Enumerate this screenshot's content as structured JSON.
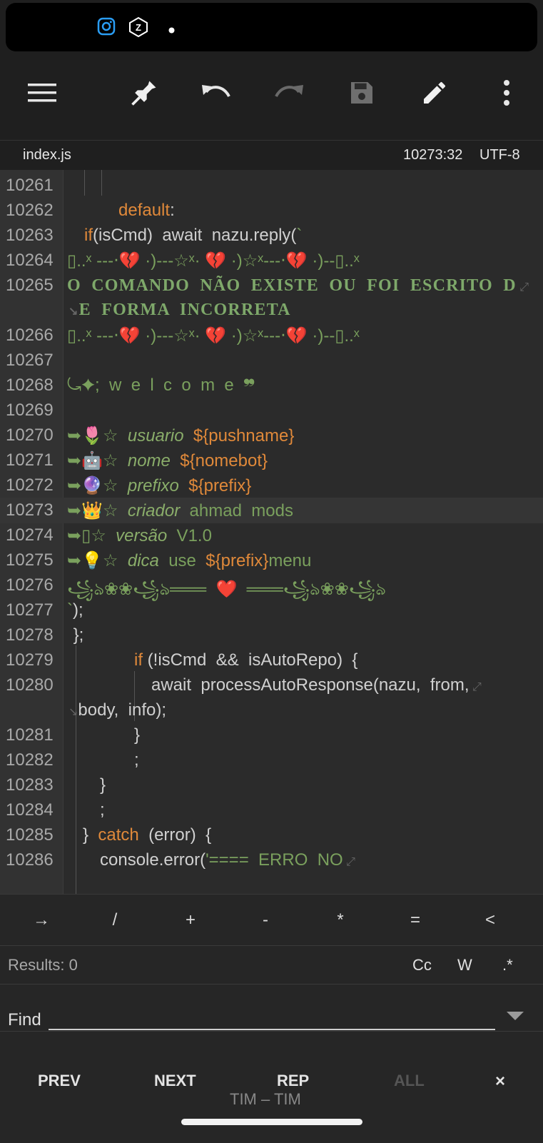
{
  "status_bar": {
    "icons": [
      "instagram-icon",
      "zapp-icon",
      "dot-icon"
    ]
  },
  "toolbar": {
    "icons": [
      "menu-icon",
      "pin-icon",
      "undo-icon",
      "redo-icon",
      "save-icon",
      "edit-icon",
      "more-vert-icon"
    ]
  },
  "file": {
    "name": "index.js",
    "position": "10273:32",
    "encoding": "UTF-8"
  },
  "editor": {
    "lines": [
      {
        "n": "10261"
      },
      {
        "n": "10262",
        "parts": [
          {
            "t": "default",
            "c": "kw"
          },
          {
            "t": ":",
            "c": ""
          }
        ],
        "indent": 166
      },
      {
        "n": "10263",
        "parts": [
          {
            "t": "if",
            "c": "kw"
          },
          {
            "t": "(isCmd)  await  nazu.reply(",
            "c": ""
          },
          {
            "t": "`",
            "c": "str"
          }
        ],
        "indent": 118
      },
      {
        "n": "10264",
        "parts": [
          {
            "t": "▯..ˣ ---‧💔 ·)---☆ˣ· 💔 ·)☆ˣ---‧💔 ·)--▯..ˣ",
            "c": "str"
          }
        ],
        "indent": 94
      },
      {
        "n": "10265",
        "parts": [
          {
            "t": "O  COMANDO  NÃO  EXISTE  OU  FOI  ESCRITO  D",
            "c": "serif"
          }
        ],
        "indent": 94,
        "wrap": "E  FORMA  INCORRETA"
      },
      {
        "n": "10266",
        "parts": [
          {
            "t": "▯..ˣ ---‧💔 ·)---☆ˣ· 💔 ·)☆ˣ---‧💔 ·)--▯..ˣ",
            "c": "str"
          }
        ],
        "indent": 94
      },
      {
        "n": "10267"
      },
      {
        "n": "10268",
        "parts": [
          {
            "t": "⤿✦;  w  e  l  c  o  m  e  ❞",
            "c": "str"
          }
        ],
        "indent": 94
      },
      {
        "n": "10269"
      },
      {
        "n": "10270",
        "parts": [
          {
            "t": "➥🌷☆  ",
            "c": "str"
          },
          {
            "t": "usuario",
            "c": "it"
          },
          {
            "t": "  ${pushname}",
            "c": "kw"
          }
        ],
        "indent": 94
      },
      {
        "n": "10271",
        "parts": [
          {
            "t": "➥🤖☆  ",
            "c": "str"
          },
          {
            "t": "nome",
            "c": "it"
          },
          {
            "t": "  ${nomebot}",
            "c": "kw"
          }
        ],
        "indent": 94
      },
      {
        "n": "10272",
        "parts": [
          {
            "t": "➥🔮☆  ",
            "c": "str"
          },
          {
            "t": "prefixo",
            "c": "it"
          },
          {
            "t": "  ${prefix}",
            "c": "kw"
          }
        ],
        "indent": 94
      },
      {
        "n": "10273",
        "parts": [
          {
            "t": "➥👑☆  ",
            "c": "str"
          },
          {
            "t": "criador",
            "c": "it"
          },
          {
            "t": "  ahmad  mods",
            "c": "str"
          }
        ],
        "indent": 94,
        "hl": true
      },
      {
        "n": "10274",
        "parts": [
          {
            "t": "➥▯☆  ",
            "c": "str"
          },
          {
            "t": "versão",
            "c": "it"
          },
          {
            "t": "  V1.0",
            "c": "str"
          }
        ],
        "indent": 94
      },
      {
        "n": "10275",
        "parts": [
          {
            "t": "➥💡☆  ",
            "c": "str"
          },
          {
            "t": "dica",
            "c": "it"
          },
          {
            "t": "  use  ",
            "c": "str"
          },
          {
            "t": "${prefix}",
            "c": "kw"
          },
          {
            "t": "menu",
            "c": "str"
          }
        ],
        "indent": 94
      },
      {
        "n": "10276",
        "parts": [
          {
            "t": "꧁ঌ❀❀꧁ঌ═══  ",
            "c": "str"
          },
          {
            "t": "❤️",
            "c": "heart"
          },
          {
            "t": "  ═══꧁ঌ❀❀꧁ঌ",
            "c": "str"
          }
        ],
        "indent": 94
      },
      {
        "n": "10277",
        "parts": [
          {
            "t": "`",
            "c": "str"
          },
          {
            "t": ");",
            "c": ""
          }
        ],
        "indent": 94
      },
      {
        "n": "10278",
        "parts": [
          {
            "t": " };",
            "c": ""
          }
        ],
        "indent": 96
      },
      {
        "n": "10279",
        "parts": [
          {
            "t": "if",
            "c": "kw"
          },
          {
            "t": " (!isCmd  &&  isAutoRepo)  {",
            "c": ""
          }
        ],
        "indent": 188
      },
      {
        "n": "10280",
        "parts": [
          {
            "t": "await  processAutoResponse(nazu,  from,",
            "c": ""
          }
        ],
        "indent": 212,
        "wrap": "body,  info);"
      },
      {
        "n": "10281",
        "parts": [
          {
            "t": "}",
            "c": ""
          }
        ],
        "indent": 188
      },
      {
        "n": "10282",
        "parts": [
          {
            "t": ";",
            "c": ""
          }
        ],
        "indent": 188
      },
      {
        "n": "10283",
        "parts": [
          {
            "t": "}",
            "c": ""
          }
        ],
        "indent": 140
      },
      {
        "n": "10284",
        "parts": [
          {
            "t": ";",
            "c": ""
          }
        ],
        "indent": 140
      },
      {
        "n": "10285",
        "parts": [
          {
            "t": "}  ",
            "c": ""
          },
          {
            "t": "catch",
            "c": "kw"
          },
          {
            "t": "  (error)  {",
            "c": ""
          }
        ],
        "indent": 116
      },
      {
        "n": "10286",
        "parts": [
          {
            "t": "console.error(",
            "c": ""
          },
          {
            "t": "'====  ERRO  NO",
            "c": "str"
          }
        ],
        "indent": 140,
        "wrapmark": true
      }
    ]
  },
  "keys": [
    "→",
    "/",
    "+",
    "-",
    "*",
    "=",
    "<"
  ],
  "results": {
    "label": "Results:",
    "count": "0",
    "options": [
      "Cc",
      "W",
      ".*"
    ]
  },
  "find": {
    "label": "Find",
    "value": "",
    "placeholder": ""
  },
  "actions": {
    "prev": "PREV",
    "next": "NEXT",
    "rep": "REP",
    "all": "ALL",
    "close": "×"
  },
  "carrier": "TIM – TIM"
}
